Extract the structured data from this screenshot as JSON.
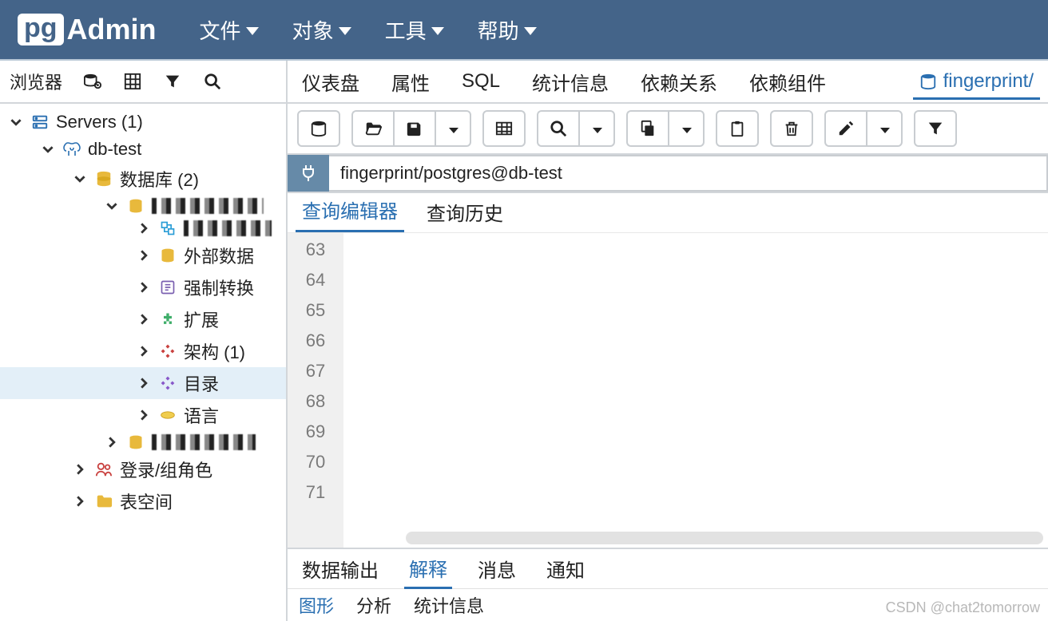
{
  "app": {
    "logoPrefix": "pg",
    "logoText": "Admin"
  },
  "menu": {
    "file": "文件",
    "object": "对象",
    "tools": "工具",
    "help": "帮助"
  },
  "sidebar": {
    "title": "浏览器",
    "servers": "Servers (1)",
    "dbtest": "db-test",
    "databases": "数据库 (2)",
    "items": {
      "ext_data": "外部数据",
      "force_cast": "强制转换",
      "extension": "扩展",
      "schema": "架构 (1)",
      "catalog": "目录",
      "language": "语言"
    },
    "login": "登录/组角色",
    "tablespace": "表空间"
  },
  "mainTabs": {
    "dashboard": "仪表盘",
    "properties": "属性",
    "sql": "SQL",
    "stats": "统计信息",
    "deps": "依赖关系",
    "dependent": "依赖组件",
    "fingerprint": "fingerprint/"
  },
  "conn": {
    "label": "fingerprint/postgres@db-test"
  },
  "editorTabs": {
    "querier": "查询编辑器",
    "history": "查询历史"
  },
  "lineNumbers": [
    "63",
    "64",
    "65",
    "66",
    "67",
    "68",
    "69",
    "70",
    "71"
  ],
  "outTabs": {
    "data": "数据输出",
    "explain": "解释",
    "msg": "消息",
    "notify": "通知"
  },
  "outSub": {
    "graph": "图形",
    "analyze": "分析",
    "stats": "统计信息"
  },
  "watermark": "CSDN @chat2tomorrow"
}
